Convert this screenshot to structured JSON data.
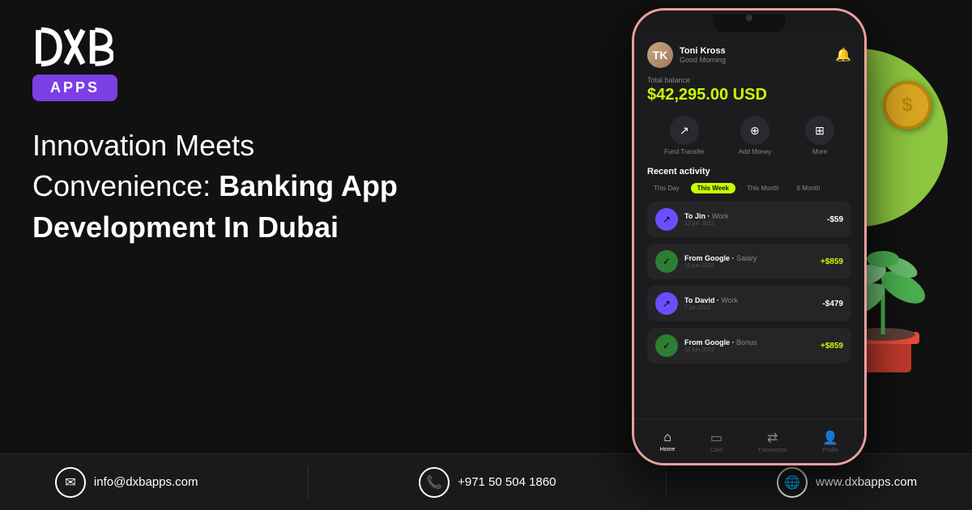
{
  "logo": {
    "dxb_text": "DXB",
    "apps_label": "APPS"
  },
  "headline": {
    "line1": "Innovation Meets",
    "line2": "Convenience: ",
    "line2_bold": "Banking App",
    "line3_bold": "Development In Dubai"
  },
  "footer": {
    "email_icon": "✉",
    "email": "info@dxbapps.com",
    "phone_icon": "📞",
    "phone": "+971 50 504 1860",
    "web_icon": "🌐",
    "website": "www.dxbapps.com"
  },
  "app": {
    "user_name": "Toni Kross",
    "greeting": "Good Morning",
    "balance_label": "Total balance",
    "balance_amount": "$42,295.00 USD",
    "actions": [
      {
        "icon": "↗",
        "label": "Fund Transfer"
      },
      {
        "icon": "⊕",
        "label": "Add Money"
      },
      {
        "icon": "⊞",
        "label": "More"
      }
    ],
    "recent_activity_label": "Recent activity",
    "tabs": [
      {
        "label": "This Day",
        "active": false
      },
      {
        "label": "This Week",
        "active": true
      },
      {
        "label": "This Month",
        "active": false
      },
      {
        "label": "6 Month",
        "active": false
      }
    ],
    "transactions": [
      {
        "icon": "↗",
        "type": "purple",
        "name": "To Jin",
        "tag": "Work",
        "date": "12 jun 2022",
        "amount": "-$59",
        "positive": false
      },
      {
        "icon": "✓",
        "type": "green",
        "name": "From Google",
        "tag": "Salary",
        "date": "10 jun 2022",
        "amount": "+$859",
        "positive": true
      },
      {
        "icon": "↗",
        "type": "purple",
        "name": "To David",
        "tag": "Work",
        "date": "7 jun 2022",
        "amount": "-$479",
        "positive": false
      },
      {
        "icon": "✓",
        "type": "green",
        "name": "From Google",
        "tag": "Bonus",
        "date": "10 jun 2022",
        "amount": "+$859",
        "positive": true
      }
    ],
    "nav": [
      {
        "icon": "⌂",
        "label": "Home",
        "active": true
      },
      {
        "icon": "▭",
        "label": "Card",
        "active": false
      },
      {
        "icon": "⇄",
        "label": "Transaction",
        "active": false
      },
      {
        "icon": "👤",
        "label": "Profile",
        "active": false
      }
    ]
  }
}
